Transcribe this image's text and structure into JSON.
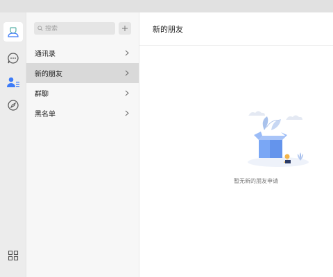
{
  "search": {
    "placeholder": "搜索"
  },
  "nav": {
    "items": [
      {
        "label": "通讯录",
        "active": false
      },
      {
        "label": "新的朋友",
        "active": true
      },
      {
        "label": "群聊",
        "active": false
      },
      {
        "label": "黑名单",
        "active": false
      }
    ]
  },
  "main": {
    "title": "新的朋友",
    "empty_text": "暂无新的朋友申请"
  },
  "icons": {
    "rail": [
      "avatar-icon",
      "chat-icon",
      "contacts-icon",
      "discover-icon",
      "apps-grid-icon"
    ],
    "search": "search-icon",
    "add": "plus-icon",
    "chevron": "chevron-right-icon"
  },
  "colors": {
    "accent": "#3d7bf7",
    "active_item": "#d9d9d9",
    "illustration_box": "#7aa7f5"
  }
}
